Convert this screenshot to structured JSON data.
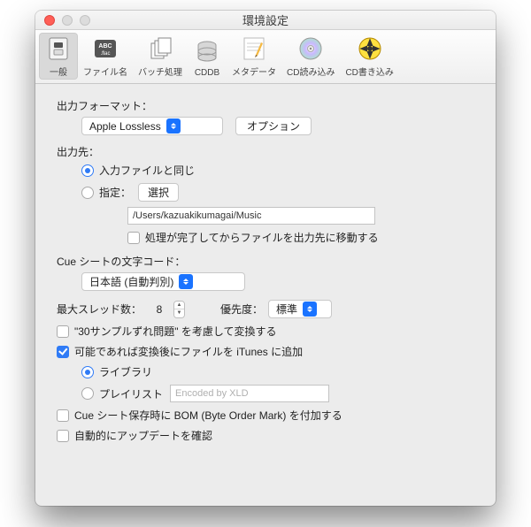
{
  "window": {
    "title": "環境設定"
  },
  "toolbar": {
    "items": [
      {
        "label": "一般"
      },
      {
        "label": "ファイル名"
      },
      {
        "label": "バッチ処理"
      },
      {
        "label": "CDDB"
      },
      {
        "label": "メタデータ"
      },
      {
        "label": "CD読み込み"
      },
      {
        "label": "CD書き込み"
      }
    ]
  },
  "output_format": {
    "label": "出力フォーマット：",
    "value": "Apple Lossless",
    "option_btn": "オプション"
  },
  "destination": {
    "label": "出力先：",
    "same_as_input": "入力ファイルと同じ",
    "specify": "指定：",
    "choose_btn": "選択",
    "path": "/Users/kazuakikumagai/Music",
    "move_after": "処理が完了してからファイルを出力先に移動する"
  },
  "cue": {
    "label": "Cue シートの文字コード：",
    "value": "日本語 (自動判別)"
  },
  "threads": {
    "label": "最大スレッド数：",
    "value": "8",
    "priority_label": "優先度：",
    "priority_value": "標準"
  },
  "options": {
    "thirty_sample": "\"30サンプルずれ問題\" を考慮して変換する",
    "add_itunes": "可能であれば変換後にファイルを iTunes に追加",
    "library": "ライブラリ",
    "playlist": "プレイリスト",
    "playlist_placeholder": "Encoded by XLD",
    "bom": "Cue シート保存時に BOM (Byte Order Mark) を付加する",
    "auto_update": "自動的にアップデートを確認"
  }
}
